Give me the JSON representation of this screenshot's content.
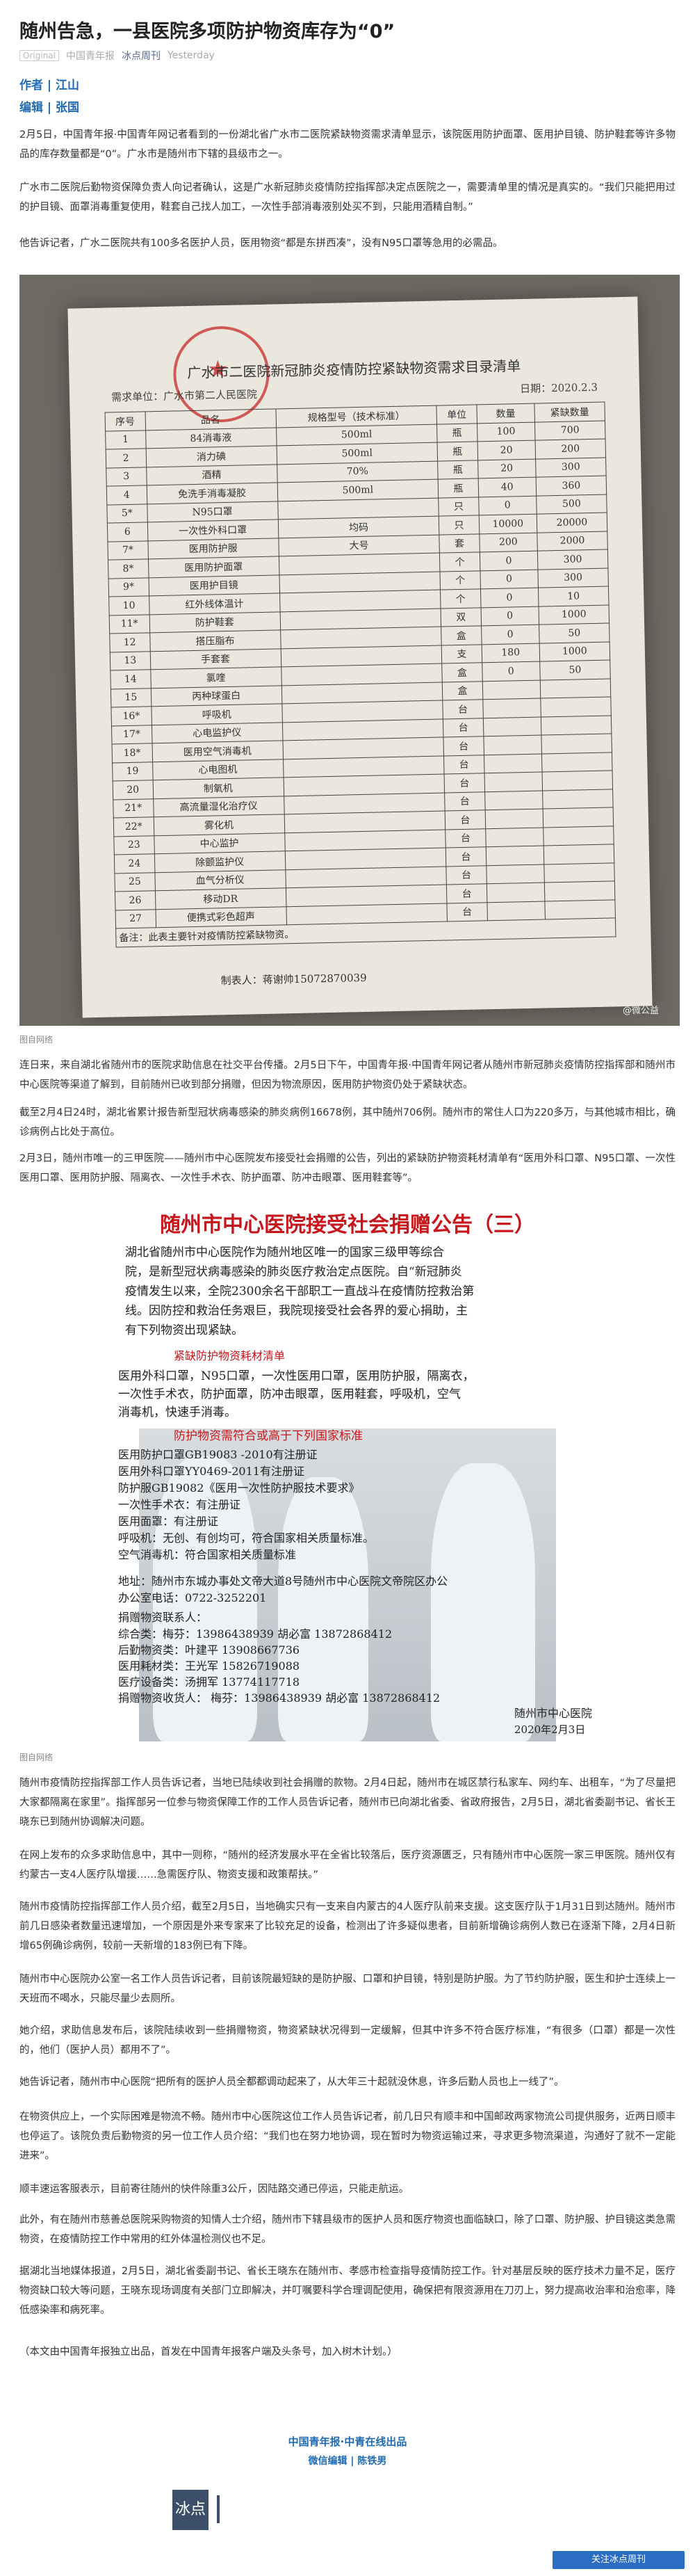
{
  "article": {
    "title": "随州告急，一县医院多项防护物资库存为“0”",
    "original_tag": "Original",
    "account_a": "中国青年报",
    "account_b": "冰点周刊",
    "time": "Yesterday",
    "author": "作者 | 江山",
    "editor": "编辑 | 张国"
  },
  "paragraphs_top": [
    "2月5日，中国青年报·中国青年网记者看到的一份湖北省广水市二医院紧缺物资需求清单显示，该院医用防护面罩、医用护目镜、防护鞋套等许多物品的库存数量都是“0”。广水市是随州市下辖的县级市之一。",
    "广水市二医院后勤物资保障负责人向记者确认，这是广水新冠肺炎疫情防控指挥部决定点医院之一，需要清单里的情况是真实的。“我们只能把用过的护目镜、面罩消毒重复使用，鞋套自己找人加工，一次性手部消毒液别处买不到，只能用酒精自制。”",
    "他告诉记者，广水二医院共有100多名医护人员，医用物资“都是东拼西凑”，没有N95口罩等急用的必需品。"
  ],
  "list_doc": {
    "title": "广水市二医院新冠肺炎疫情防控紧缺物资需求目录清单",
    "unit": "需求单位：广水市第二人民医院",
    "date": "日期：2020.2.3",
    "headers": [
      "序号",
      "品名",
      "规格型号（技术标准）",
      "单位",
      "数量",
      "紧缺数量"
    ],
    "rows": [
      [
        "1",
        "84消毒液",
        "500ml",
        "瓶",
        "100",
        "700"
      ],
      [
        "2",
        "消力碘",
        "500ml",
        "瓶",
        "20",
        "200"
      ],
      [
        "3",
        "酒精",
        "70%",
        "瓶",
        "20",
        "300"
      ],
      [
        "4",
        "免洗手消毒凝胶",
        "500ml",
        "瓶",
        "40",
        "360"
      ],
      [
        "5*",
        "N95口罩",
        "",
        "只",
        "0",
        "500"
      ],
      [
        "6",
        "一次性外科口罩",
        "均码",
        "只",
        "10000",
        "20000"
      ],
      [
        "7*",
        "医用防护服",
        "大号",
        "套",
        "200",
        "2000"
      ],
      [
        "8*",
        "医用防护面罩",
        "",
        "个",
        "0",
        "300"
      ],
      [
        "9*",
        "医用护目镜",
        "",
        "个",
        "0",
        "300"
      ],
      [
        "10",
        "红外线体温计",
        "",
        "个",
        "0",
        "10"
      ],
      [
        "11*",
        "防护鞋套",
        "",
        "双",
        "0",
        "1000"
      ],
      [
        "12",
        "搭压脂布",
        "",
        "盒",
        "0",
        "50"
      ],
      [
        "13",
        "手套套",
        "",
        "支",
        "180",
        "1000"
      ],
      [
        "14",
        "氯喹",
        "",
        "盒",
        "0",
        "50"
      ],
      [
        "15",
        "丙种球蛋白",
        "",
        "盒",
        "",
        ""
      ],
      [
        "16*",
        "呼吸机",
        "",
        "台",
        "",
        ""
      ],
      [
        "17*",
        "心电监护仪",
        "",
        "台",
        "",
        ""
      ],
      [
        "18*",
        "医用空气消毒机",
        "",
        "台",
        "",
        ""
      ],
      [
        "19",
        "心电图机",
        "",
        "台",
        "",
        ""
      ],
      [
        "20",
        "制氧机",
        "",
        "台",
        "",
        ""
      ],
      [
        "21*",
        "高流量湿化治疗仪",
        "",
        "台",
        "",
        ""
      ],
      [
        "22*",
        "雾化机",
        "",
        "台",
        "",
        ""
      ],
      [
        "23",
        "中心监护",
        "",
        "台",
        "",
        ""
      ],
      [
        "24",
        "除颤监护仪",
        "",
        "台",
        "",
        ""
      ],
      [
        "25",
        "血气分析仪",
        "",
        "台",
        "",
        ""
      ],
      [
        "26",
        "移动DR",
        "",
        "台",
        "",
        ""
      ],
      [
        "27",
        "便携式彩色超声",
        "",
        "台",
        "",
        ""
      ]
    ],
    "note": "备注：此表主要针对疫情防控紧缺物资。",
    "preparer": "制表人：蒋谢帅15072870039",
    "watermark": "@微公益"
  },
  "caption1": "图自网络",
  "paragraphs_mid": [
    "连日来，来自湖北省随州市的医院求助信息在社交平台传播。2月5日下午，中国青年报·中国青年网记者从随州市新冠肺炎疫情防控指挥部和随州市中心医院等渠道了解到，目前随州已收到部分捐赠，但因为物流原因，医用防护物资仍处于紧缺状态。",
    "截至2月4日24时，湖北省累计报告新型冠状病毒感染的肺炎病例16678例，其中随州706例。随州市的常住人口为220多万，与其他城市相比，确诊病例占比处于高位。",
    "2月3日，随州市唯一的三甲医院——随州市中心医院发布接受社会捐赠的公告，列出的紧缺防护物资耗材清单有“医用外科口罩、N95口罩、一次性医用口罩、医用防护服、隔离衣、一次性手术衣、防护面罩、防冲击眼罩、医用鞋套等”。"
  ],
  "poster": {
    "title": "随州市中心医院接受社会捐赠公告（三）",
    "intro": [
      "湖北省随州市中心医院作为随州地区唯一的国家三级甲等综合",
      "院，是新型冠状病毒感染的肺炎医疗救治定点医院。自“新冠肺炎",
      "疫情发生以来，全院2300余名干部职工一直战斗在疫情防控救治第",
      "线。因防控和救治任务艰巨，我院现接受社会各界的爱心捐助，主",
      "有下列物资出现紧缺。"
    ],
    "list_heading": "紧缺防护物资耗材清单",
    "list_lines": [
      "医用外科口罩，N95口罩，一次性医用口罩，医用防护服，隔离衣，",
      "一次性手术衣，防护面罩，防冲击眼罩，医用鞋套，呼吸机，空气",
      "消毒机，快速手消毒。"
    ],
    "std_heading": "防护物资需符合或高于下列国家标准",
    "std_lines": [
      "医用防护口罩GB19083 -2010有注册证",
      "医用外科口罩YY0469-2011有注册证",
      "防护服GB19082《医用一次性防护服技术要求》",
      "一次性手术衣：有注册证",
      "医用面罩：有注册证",
      "呼吸机：无创、有创均可，符合国家相关质量标准。",
      "空气消毒机：符合国家相关质量标准"
    ],
    "address": [
      "地址：随州市东城办事处文帝大道8号随州市中心医院文帝院区办公",
      "办公室电话：0722-3252201"
    ],
    "contacts_heading": "捐赠物资联系人：",
    "contacts": [
      "综合类：梅芬：13986438939    胡必富 13872868412",
      "后勤物资类：叶建平 13908667736",
      "医用耗材类：王光军 15826719088",
      "医疗设备类：汤拥军 13774117718",
      "捐赠物资收货人：  梅芬：13986438939    胡必富  13872868412"
    ],
    "signature": "随州市中心医院",
    "date": "2020年2月3日"
  },
  "caption2": "图自网络",
  "paragraphs_bottom": [
    "随州市疫情防控指挥部工作人员告诉记者，当地已陆续收到社会捐赠的款物。2月4日起，随州市在城区禁行私家车、网约车、出租车，“为了尽量把大家都隔离在家里”。指挥部另一位参与物资保障工作的工作人员告诉记者，随州市已向湖北省委、省政府报告，2月5日，湖北省委副书记、省长王晓东已到随州协调解决问题。",
    "在网上发布的众多求助信息中，其中一则称，“随州的经济发展水平在全省比较落后，医疗资源匮乏，只有随州市中心医院一家三甲医院。随州仅有约蒙古一支4人医疗队增援……急需医疗队、物资支援和政策帮扶。”",
    "随州市疫情防控指挥部工作人员介绍，截至2月5日，当地确实只有一支来自内蒙古的4人医疗队前来支援。这支医疗队于1月31日到达随州。随州市前几日感染者数量迅速增加，一个原因是外来专家来了比较充足的设备，检测出了许多疑似患者，目前新增确诊病例人数已在逐渐下降，2月4日新增65例确诊病例，较前一天新增的183例已有下降。",
    "随州市中心医院办公室一名工作人员告诉记者，目前该院最短缺的是防护服、口罩和护目镜，特别是防护服。为了节约防护服，医生和护士连续上一天班而不喝水，只能尽量少去厕所。",
    "她介绍，求助信息发布后，该院陆续收到一些捐赠物资，物资紧缺状况得到一定缓解，但其中许多不符合医疗标准，“有很多（口罩）都是一次性的，他们（医护人员）都用不了”。",
    "她告诉记者，随州市中心医院“把所有的医护人员全都都调动起来了，从大年三十起就没休息，许多后勤人员也上一线了”。",
    "在物资供应上，一个实际困难是物流不畅。随州市中心医院这位工作人员告诉记者，前几日只有顺丰和中国邮政两家物流公司提供服务，近两日顺丰也停运了。该院负责后勤物资的另一位工作人员介绍：“我们也在努力地协调，现在暂时为物资运输过来，寻求更多物流渠道，沟通好了就不一定能进来”。",
    "顺丰速运客服表示，目前寄往随州的快件除重3公斤，因陆路交通已停运，只能走航运。",
    "此外，有在随州市慈善总医院采购物资的知情人士介绍，随州市下辖县级市的医护人员和医疗物资也面临缺口，除了口罩、防护服、护目镜这类急需物资，在疫情防控工作中常用的红外体温检测仪也不足。",
    "据湖北当地媒体报道，2月5日，湖北省委副书记、省长王晓东在随州市、孝感市检查指导疫情防控工作。针对基层反映的医疗技术力量不足，医疗物资缺口较大等问题，王晓东现场调度有关部门立即解决，并叮嘱要科学合理调配使用，确保把有限资源用在刀刃上，努力提高收治率和治愈率，降低感染率和病死率。",
    "（本文由中国青年报独立出品，首发在中国青年报客户端及头条号，加入树木计划。）"
  ],
  "footer": {
    "line1": "中国青年报·中青在线出品",
    "line2": "微信编辑 | 陈铁男",
    "logo_text": "冰点",
    "follow_text": "关注冰点周刊"
  },
  "colors": {
    "link_blue": "#1f6bb5",
    "accent_red": "#c8161d"
  }
}
